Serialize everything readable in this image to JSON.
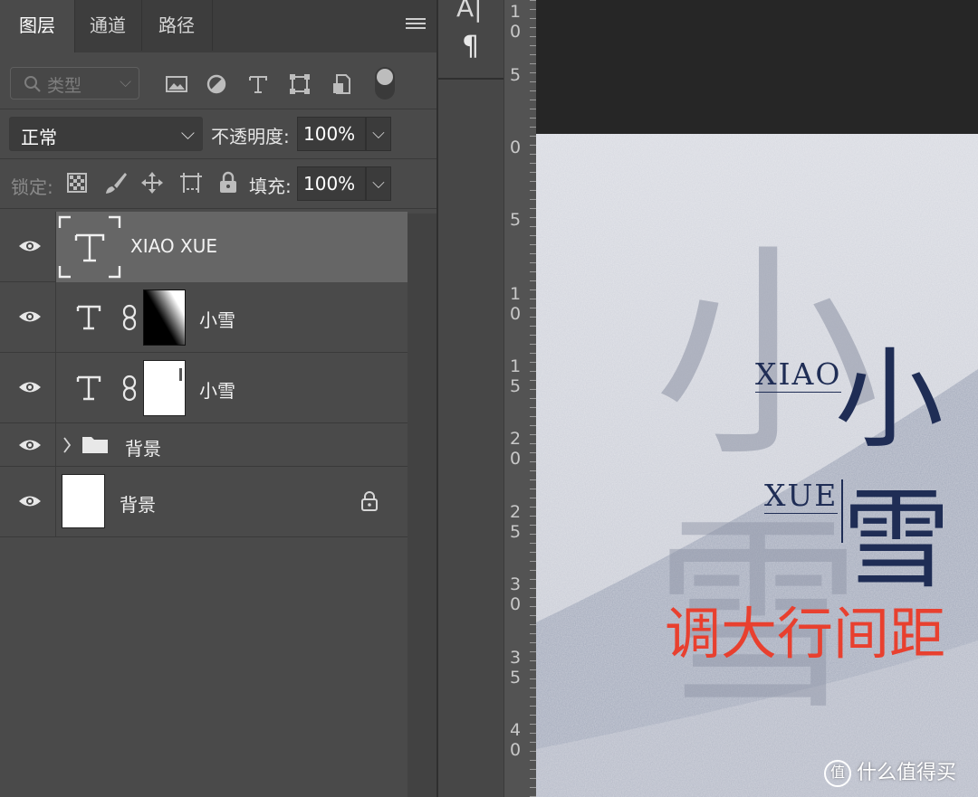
{
  "layers_panel": {
    "tabs": [
      {
        "label": "图层",
        "active": true
      },
      {
        "label": "通道",
        "active": false
      },
      {
        "label": "路径",
        "active": false
      }
    ],
    "filter": {
      "type_label": "类型"
    },
    "blend_mode": "正常",
    "opacity_label": "不透明度:",
    "opacity_value": "100%",
    "lock_label": "锁定:",
    "fill_label": "填充:",
    "fill_value": "100%",
    "layers": [
      {
        "name": "XIAO XUE",
        "kind": "text",
        "selected": true,
        "visible": true
      },
      {
        "name": "小雪",
        "kind": "text-with-mask",
        "visible": true
      },
      {
        "name": "小雪",
        "kind": "text-with-mask",
        "visible": true
      },
      {
        "name": "背景",
        "kind": "group",
        "visible": true,
        "collapsed": true
      },
      {
        "name": "背景",
        "kind": "background",
        "visible": true,
        "locked": true
      }
    ]
  },
  "side_toolbar": {
    "items": [
      "character-panel-icon",
      "paragraph-icon"
    ]
  },
  "ruler": {
    "labels": [
      {
        "d1": "1",
        "d2": "0"
      },
      {
        "d1": "5",
        "d2": ""
      },
      {
        "d1": "0",
        "d2": ""
      },
      {
        "d1": "5",
        "d2": ""
      },
      {
        "d1": "1",
        "d2": "0"
      },
      {
        "d1": "1",
        "d2": "5"
      },
      {
        "d1": "2",
        "d2": "0"
      },
      {
        "d1": "2",
        "d2": "5"
      },
      {
        "d1": "3",
        "d2": "0"
      },
      {
        "d1": "3",
        "d2": "5"
      },
      {
        "d1": "4",
        "d2": "0"
      }
    ]
  },
  "canvas": {
    "big_char_1": "小",
    "big_char_2": "雪",
    "text_xiao": "XIAO",
    "text_xue": "XUE",
    "annotation": "调大行间距",
    "watermark": "什么值得买",
    "colors": {
      "navy": "#1f2d55",
      "annotation_red": "#e8402f",
      "bg_light": "#d3d6df",
      "bg_dark": "#aab0c0"
    }
  }
}
